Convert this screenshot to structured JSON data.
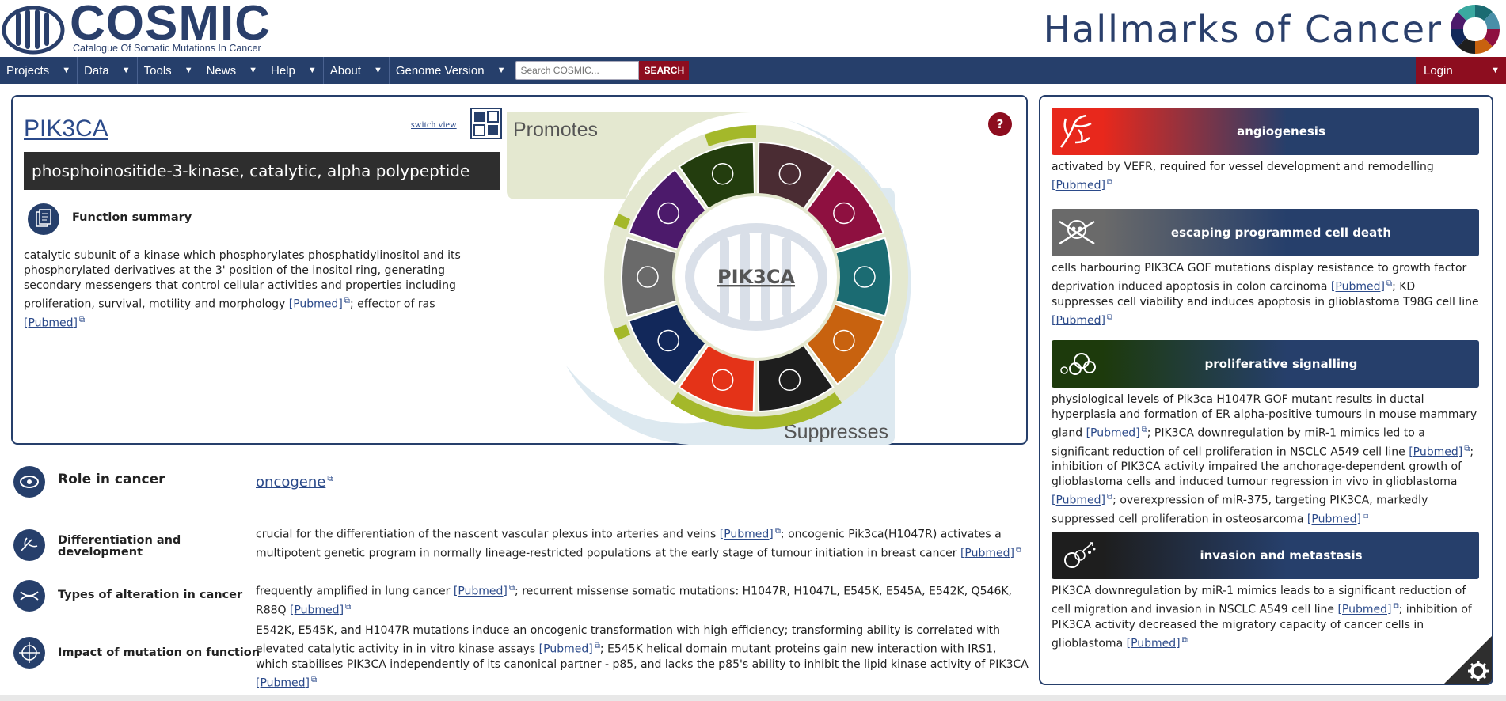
{
  "header": {
    "logo_word": "COSMIC",
    "logo_subtitle": "Catalogue Of Somatic Mutations In Cancer",
    "title": "Hallmarks of Cancer"
  },
  "nav": {
    "items": [
      {
        "label": "Projects"
      },
      {
        "label": "Data"
      },
      {
        "label": "Tools"
      },
      {
        "label": "News"
      },
      {
        "label": "Help"
      },
      {
        "label": "About"
      },
      {
        "label": "Genome Version"
      }
    ],
    "search_placeholder": "Search COSMIC...",
    "search_button": "SEARCH",
    "login": "Login",
    "caret": "▼"
  },
  "gene": {
    "symbol": "PIK3CA",
    "switch_view": "switch view",
    "full_name": "phosphoinositide-3-kinase, catalytic, alpha polypeptide",
    "function_title": "Function summary",
    "function_text_1": "catalytic subunit of a kinase which phosphorylates phosphatidylinositol and its phosphorylated derivatives at the 3' position of the inositol ring, generating secondary messengers that control cellular activities and properties including proliferation, survival, motility and morphology ",
    "function_text_2": "; effector of ras ",
    "pubmed": "[Pubmed]",
    "help": "?"
  },
  "wheel": {
    "promotes": "Promotes",
    "suppresses": "Suppresses",
    "center_label": "PIK3CA",
    "colors": {
      "promote_bg": "#e4e8d0",
      "suppress_bg": "#dde9f0",
      "ring_lime": "#a4b82a",
      "segments": [
        "#233d0e",
        "#4a2c33",
        "#8e1040",
        "#1b6b72",
        "#c8620f",
        "#1e1e1e",
        "#e43318",
        "#12285a",
        "#6a6a6a",
        "#4c1a6b"
      ]
    }
  },
  "rows": {
    "role_label": "Role in cancer",
    "role_value": "oncogene",
    "diff_label": "Differentiation and development",
    "diff_text_1": "crucial for the differentiation of the nascent vascular plexus into arteries and veins ",
    "diff_text_2": "; oncogenic Pik3ca(H1047R) activates a multipotent genetic program in normally lineage-restricted populations at the early stage of tumour initiation in breast cancer ",
    "types_label": "Types of alteration in cancer",
    "types_text_1": "frequently amplified in lung cancer ",
    "types_text_2": "; recurrent missense somatic mutations: H1047R, H1047L, E545K, E545A, E542K, Q546K, R88Q ",
    "impact_label": "Impact of mutation on function",
    "impact_text_1": "E542K, E545K, and H1047R mutations induce an oncogenic transformation with high efficiency; transforming ability is correlated with elevated catalytic activity in in vitro kinase assays ",
    "impact_text_2": "; E545K helical domain mutant proteins gain new interaction with IRS1, which stabilises PIK3CA independently of its canonical partner - p85, and lacks the p85's ability to inhibit the lipid kinase activity of PIK3CA "
  },
  "hallmarks": {
    "angio": {
      "title": "angiogenesis",
      "text_1": "activated by VEFR, required for vessel development and remodelling ",
      "gradient": [
        "#e8281c",
        "#263f6b"
      ]
    },
    "death": {
      "title": "escaping programmed cell death",
      "text_1": "cells harbouring PIK3CA GOF mutations display resistance to growth factor deprivation induced apoptosis in colon carcinoma ",
      "text_2": "; KD suppresses cell viability and induces apoptosis in glioblastoma T98G cell line ",
      "gradient": [
        "#6a6a6a",
        "#263f6b"
      ]
    },
    "prolif": {
      "title": "proliferative signalling",
      "text_1": "physiological levels of Pik3ca H1047R GOF mutant results in ductal hyperplasia and formation of ER alpha-positive tumours in mouse mammary gland ",
      "text_2": "; PIK3CA downregulation by miR-1 mimics led to a significant reduction of cell proliferation in NSCLC A549 cell line ",
      "text_3": "; inhibition of PIK3CA activity impaired the anchorage-dependent growth of glioblastoma cells and induced tumour regression in vivo in glioblastoma ",
      "text_4": "; overexpression of miR-375, targeting PIK3CA, markedly suppressed cell proliferation in osteosarcoma ",
      "gradient": [
        "#1d3a0c",
        "#263f6b"
      ]
    },
    "invasion": {
      "title": "invasion and metastasis",
      "text_1": "PIK3CA downregulation by miR-1 mimics leads to a significant reduction of cell migration and invasion in NSCLC A549 cell line ",
      "text_2": "; inhibition of PIK3CA activity decreased the migratory capacity of cancer cells in glioblastoma ",
      "gradient": [
        "#1e1e1e",
        "#263f6b"
      ]
    }
  }
}
